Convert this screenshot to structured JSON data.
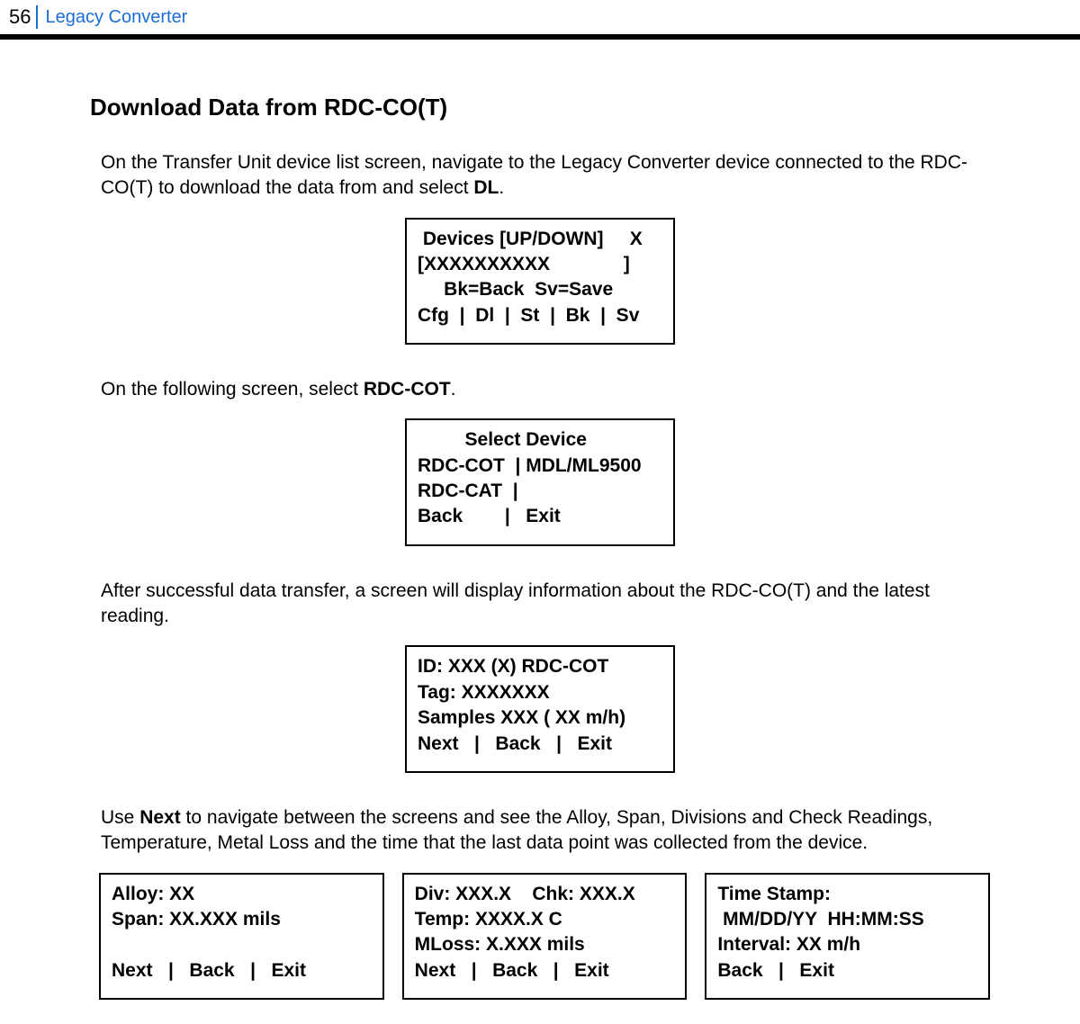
{
  "header": {
    "page_number": "56",
    "title": "Legacy Converter"
  },
  "section_title": "Download Data from RDC-CO(T)",
  "para1_pre": "On the Transfer Unit device list screen, navigate to the Legacy Converter device connected to the RDC-CO(T) to download the data from and select ",
  "para1_bold": "DL",
  "para1_post": ".",
  "screen1": " Devices [UP/DOWN]     X\n[XXXXXXXXXX              ]\n     Bk=Back  Sv=Save\nCfg  |  Dl  |  St  |  Bk  |  Sv",
  "para2_pre": "On the following screen, select ",
  "para2_bold": "RDC-COT",
  "para2_post": ".",
  "screen2": "         Select Device\nRDC-COT  | MDL/ML9500\nRDC-CAT  |\nBack        |   Exit",
  "para3": "After successful data transfer, a screen will display information about the RDC-CO(T) and the latest reading.",
  "screen3": "ID: XXX (X) RDC-COT\nTag: XXXXXXX\nSamples XXX ( XX m/h)\nNext   |   Back   |   Exit",
  "para4_pre": "Use ",
  "para4_bold": "Next",
  "para4_post": " to navigate between the screens and see the Alloy, Span, Divisions and Check Readings, Temperature, Metal Loss and the time that the last data point was collected from the device.",
  "screenA": "Alloy: XX\nSpan: XX.XXX mils\n\nNext   |   Back   |   Exit",
  "screenB": "Div: XXX.X    Chk: XXX.X\nTemp: XXXX.X C\nMLoss: X.XXX mils\nNext   |   Back   |   Exit",
  "screenC": "Time Stamp:\n MM/DD/YY  HH:MM:SS\nInterval: XX m/h\nBack   |   Exit"
}
